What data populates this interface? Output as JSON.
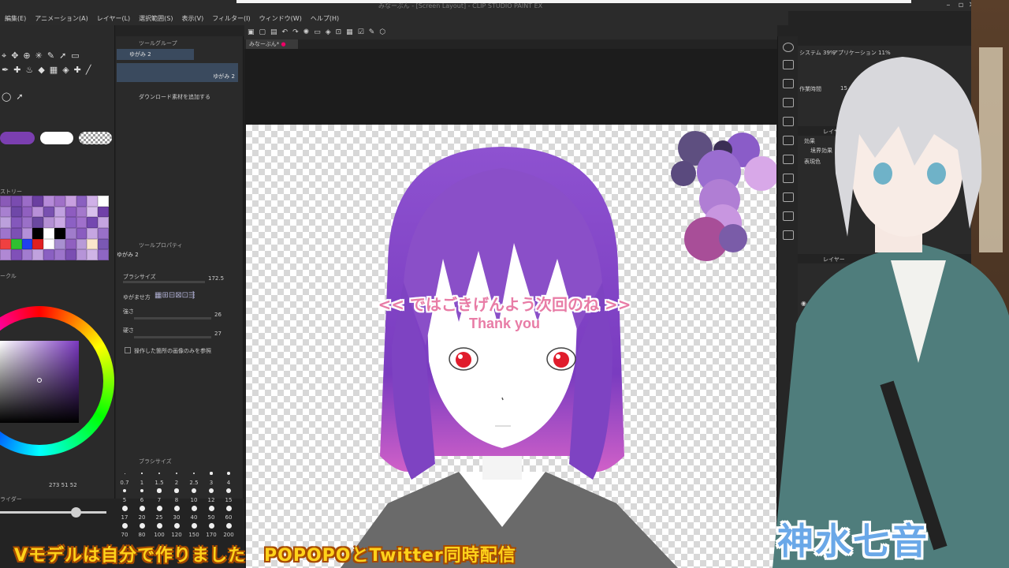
{
  "window": {
    "app_title": "みなーぶん - [Screen Layout] - CLIP STUDIO PAINT EX"
  },
  "menu": [
    "編集(E)",
    "アニメーション(A)",
    "レイヤー(L)",
    "選択範囲(S)",
    "表示(V)",
    "フィルター(I)",
    "ウィンドウ(W)",
    "ヘルプ(H)"
  ],
  "sub_tool": {
    "group_label": "ツールグループ",
    "selected_item": "ゆがみ 2",
    "selected_item_alt": "ゆがみ 2",
    "download_label": "ダウンロード素材を追加する"
  },
  "history_label": "ストリー",
  "wheel_label": "ークル",
  "tool_property": {
    "header": "ツールプロパティ",
    "tool_name": "ゆがみ 2",
    "brush_size_label": "ブラシサイズ",
    "brush_size_value": "172.5",
    "warp_label": "ゆがませ方",
    "strength_label": "強さ",
    "strength_value": "26",
    "hardness_label": "硬さ",
    "hardness_value": "27",
    "checkbox_label": "操作した箇所の画像のみを参照"
  },
  "color_readout": {
    "r": "273",
    "g": "51",
    "b": "52"
  },
  "brush_size_panel": {
    "header": "ブラシサイズ",
    "sizes": [
      "0.7",
      "1",
      "1.5",
      "2",
      "2.5",
      "3",
      "4",
      "5",
      "6",
      "7",
      "8",
      "10",
      "12",
      "15",
      "17",
      "20",
      "25",
      "30",
      "40",
      "50",
      "60",
      "70",
      "80",
      "100",
      "120",
      "150",
      "170",
      "200"
    ]
  },
  "slider_label": "ライダー",
  "canvas": {
    "tab_label": "みなーぶん*"
  },
  "right_panel": {
    "system_label": "システム 39%",
    "app_label": "アプリケーション 11%",
    "work_time_label": "作業時間",
    "work_time_value": "15",
    "layer_prop_label": "レイヤー",
    "effect_label": "効果",
    "border_label": "境界効果",
    "expression_label": "表現色",
    "layer_label": "レイヤー",
    "blend_label": "通常"
  },
  "subtitle": {
    "jp": "<< ではごきげんよう次回のね >>",
    "en": "Thank you"
  },
  "bottom_banner": "Vモデルは自分で作りました　POPOPOとTwitter同時配信",
  "name_tag": "神水七音",
  "colors": {
    "hair_purple": "#8a4fc8",
    "accent_pink": "#e87ca6",
    "banner_yellow": "#ffd21a",
    "name_blue": "#6aa8e8"
  }
}
